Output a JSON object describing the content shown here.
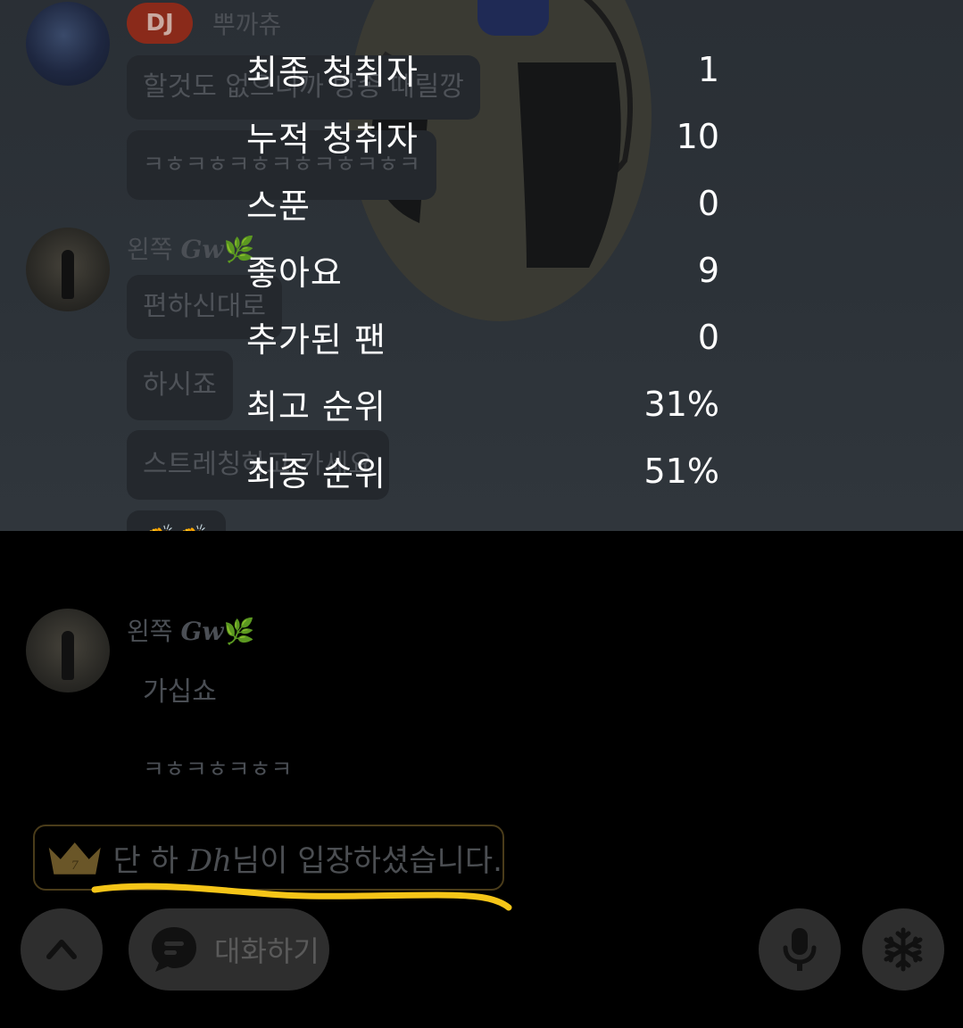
{
  "stats": [
    {
      "label": "최종 청취자",
      "value": "1"
    },
    {
      "label": "누적 청취자",
      "value": "10"
    },
    {
      "label": "스푼",
      "value": "0"
    },
    {
      "label": "좋아요",
      "value": "9"
    },
    {
      "label": "추가된 팬",
      "value": "0"
    },
    {
      "label": "최고 순위",
      "value": "31%"
    },
    {
      "label": "최종 순위",
      "value": "51%"
    }
  ],
  "chat": {
    "dj_badge": "DJ",
    "dj_name": "뿌까츄",
    "dj_messages": [
      "할것도 없으니까 방종 때릴깡",
      "ㅋㅎㅋㅎㅋㅎㅋㅎㅋㅎㅋㅎㅋ"
    ],
    "user_name_prefix": "왼쪽",
    "user_name_script": "Gw",
    "user_name_emoji": "🌿",
    "user_messages_1": [
      "편하신대로",
      "하시죠",
      "스트레칭하고 가세요",
      "👏👏"
    ],
    "user_messages_2": [
      "가십쇼",
      "ㅋㅎㅋㅎㅋㅎㅋ"
    ]
  },
  "entry_notice": {
    "prefix": "단 하 ",
    "script": "Dh",
    "suffix": "님이 입장하셨습니다.",
    "crown_rank": "7"
  },
  "bottom_bar": {
    "chat_label": "대화하기",
    "icons": [
      "chevron-up-icon",
      "chat-bubble-icon",
      "microphone-icon",
      "snowflake-icon"
    ]
  },
  "colors": {
    "highlight_underline": "#f5c518",
    "dj_badge": "#8a2a1a"
  }
}
